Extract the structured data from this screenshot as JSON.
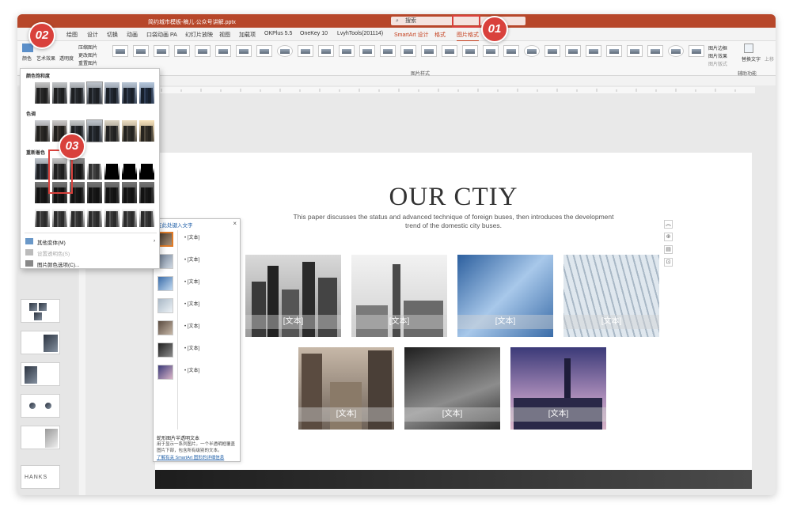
{
  "window": {
    "title": "简约城市模板-稿儿·公众号讲解.pptx",
    "search_placeholder": "搜索"
  },
  "tabs": [
    "绘图",
    "设计",
    "切换",
    "动画",
    "口袋动画 PA",
    "幻灯片放映",
    "视图",
    "加载项",
    "OKPlus 5.5",
    "OneKey 10",
    "LvyhTools(201114)",
    "SmartArt 设计",
    "格式",
    "图片格式"
  ],
  "ribbon": {
    "adjust": {
      "color": "颜色",
      "artistic_effects": "艺术效果",
      "transparency": "透明度",
      "compress": "压缩图片",
      "change": "更改图片",
      "reset": "重置图片"
    },
    "styles_group_label": "图片样式",
    "right": {
      "border": "图片边框",
      "effects": "图片效果",
      "layout": "图片版式",
      "alt_text": "替换文字",
      "accessibility_label": "辅助功能",
      "up": "上移"
    }
  },
  "color_menu": {
    "saturation_label": "颜色饱和度",
    "tone_label": "色调",
    "recolor_label": "重新着色",
    "more_variations": "其他变体(M)",
    "set_transparent": "设置透明色(S)",
    "picture_color_options": "图片颜色选项(C)..."
  },
  "slide": {
    "title": "OUR CTIY",
    "subtitle_line1": "This paper discusses the status and advanced technique of foreign buses, then introduces the development",
    "subtitle_line2": "trend of the domestic city buses.",
    "captions": [
      "[文本]",
      "[文本]",
      "[文本]",
      "[文本]",
      "[文本]",
      "[文本]",
      "[文本]"
    ]
  },
  "text_pane": {
    "title": "在此处键入文字",
    "bullets": [
      "[文本]",
      "[文本]",
      "[文本]",
      "[文本]",
      "[文本]",
      "[文本]",
      "[文本]"
    ],
    "footer_title": "蛇形图片半透明文本",
    "footer_desc": "用于显示一系列图片。一个半透明框覆盖图片下部，包含所有级别的文本。",
    "footer_link": "了解有关 SmartArt 图形的详细信息"
  },
  "thumbnail_text": "HANKS",
  "badges": [
    "01",
    "02",
    "03"
  ],
  "colors": {
    "accent": "#b7472a",
    "highlight": "#d9413c"
  }
}
